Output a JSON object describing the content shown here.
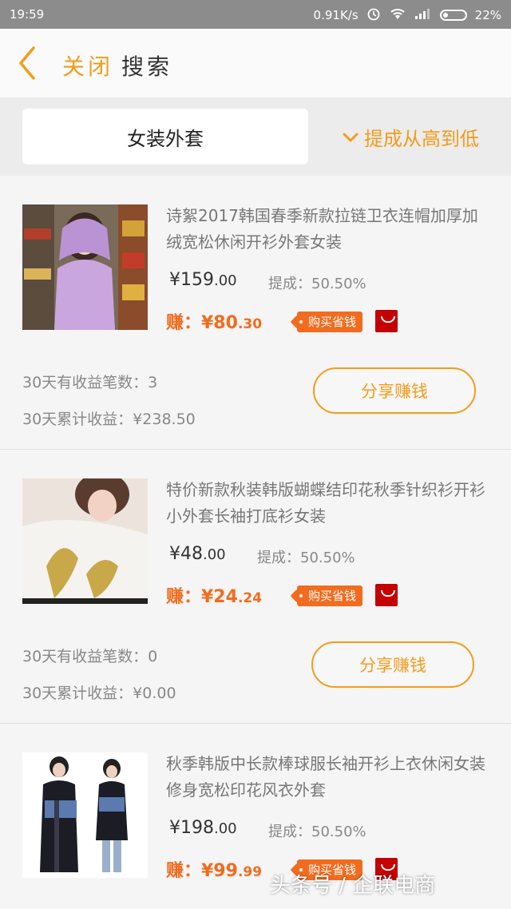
{
  "status_bar": {
    "time": "19:59",
    "network_speed": "0.91K/s",
    "battery": "22%"
  },
  "header": {
    "close_label": "关闭",
    "search_label": "搜索"
  },
  "search": {
    "query": "女装外套",
    "sort_label": "提成从高到低"
  },
  "products": [
    {
      "title": "诗絮2017韩国春季新款拉链卫衣连帽加厚加绒宽松休闲开衫外套女装",
      "price_main": "¥159",
      "price_cents": ".00",
      "commission": "提成：50.50%",
      "earn_main": "赚：¥80",
      "earn_cents": ".30",
      "tag": "购买省钱",
      "orders_30d": "30天有收益笔数：3",
      "income_30d": "30天累计收益：¥238.50",
      "share_label": "分享赚钱"
    },
    {
      "title": "特价新款秋装韩版蝴蝶结印花秋季针织衫开衫小外套长袖打底衫女装",
      "price_main": "¥48",
      "price_cents": ".00",
      "commission": "提成：50.50%",
      "earn_main": "赚：¥24",
      "earn_cents": ".24",
      "tag": "购买省钱",
      "orders_30d": "30天有收益笔数：0",
      "income_30d": "30天累计收益：¥0.00",
      "share_label": "分享赚钱"
    },
    {
      "title": "秋季韩版中长款棒球服长袖开衫上衣休闲女装修身宽松印花风衣外套",
      "price_main": "¥198",
      "price_cents": ".00",
      "commission": "提成：50.50%",
      "earn_main": "赚：¥99",
      "earn_cents": ".99",
      "tag": "购买省钱"
    }
  ],
  "watermark": "头条号 / 企联电商",
  "colors": {
    "accent": "#f39c1b",
    "earn": "#f36b1e",
    "tmall": "#c40000"
  }
}
